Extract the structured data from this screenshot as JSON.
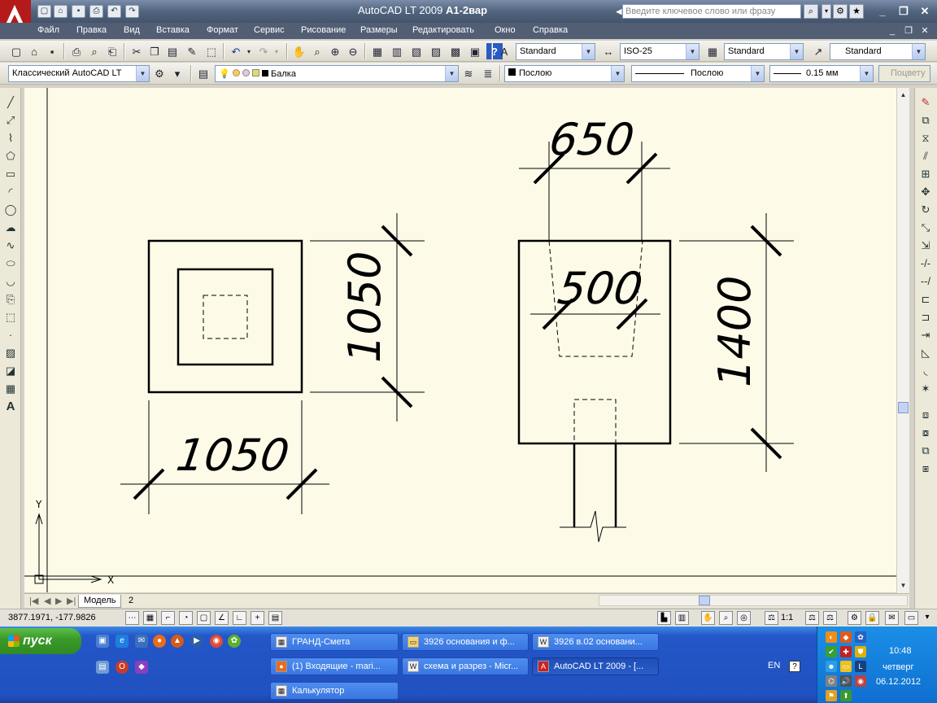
{
  "window": {
    "app_title": "AutoCAD LT 2009",
    "document_name": "А1-2вар",
    "search_placeholder": "Введите ключевое слово или фразу"
  },
  "menu": {
    "items": [
      "Файл",
      "Правка",
      "Вид",
      "Вставка",
      "Формат",
      "Сервис",
      "Рисование",
      "Размеры",
      "Редактировать",
      "Окно",
      "Справка"
    ]
  },
  "toolbar": {
    "text_style": "Standard",
    "dim_style": "ISO-25",
    "table_style": "Standard",
    "mleader_style": "Standard",
    "workspace": "Классический AutoCAD LT",
    "layer": "Балка",
    "color": "Послою",
    "linetype": "Послою",
    "lineweight": "0.15 мм",
    "plot_style": "Поцвету"
  },
  "drawing": {
    "dim_left_horizontal": "1050",
    "dim_left_vertical": "1050",
    "dim_right_top": "650",
    "dim_right_inner": "500",
    "dim_right_vertical": "1400",
    "ucs_x": "X",
    "ucs_y": "Y"
  },
  "tabs": {
    "model": "Модель",
    "layout2": "2"
  },
  "status": {
    "coordinates": "3877.1971, -177.9826",
    "annotation_scale": "1:1"
  },
  "taskbar": {
    "start_label": "пуск",
    "tasks": [
      "ГРАНД-Смета",
      "3926 основания и ф...",
      "3926 в.02 основани...",
      "(1) Входящие - mari...",
      "схема и разрез - Micr...",
      "AutoCAD LT 2009 - [...",
      "Калькулятор"
    ],
    "language": "EN",
    "time": "10:48",
    "weekday": "четверг",
    "date": "06.12.2012"
  },
  "colors": {
    "canvas_background": "#fdfbe8",
    "titlebar": "#52657f",
    "menubar": "#515e74",
    "taskbar": "#2456c8",
    "start_button": "#3a9a2a"
  }
}
